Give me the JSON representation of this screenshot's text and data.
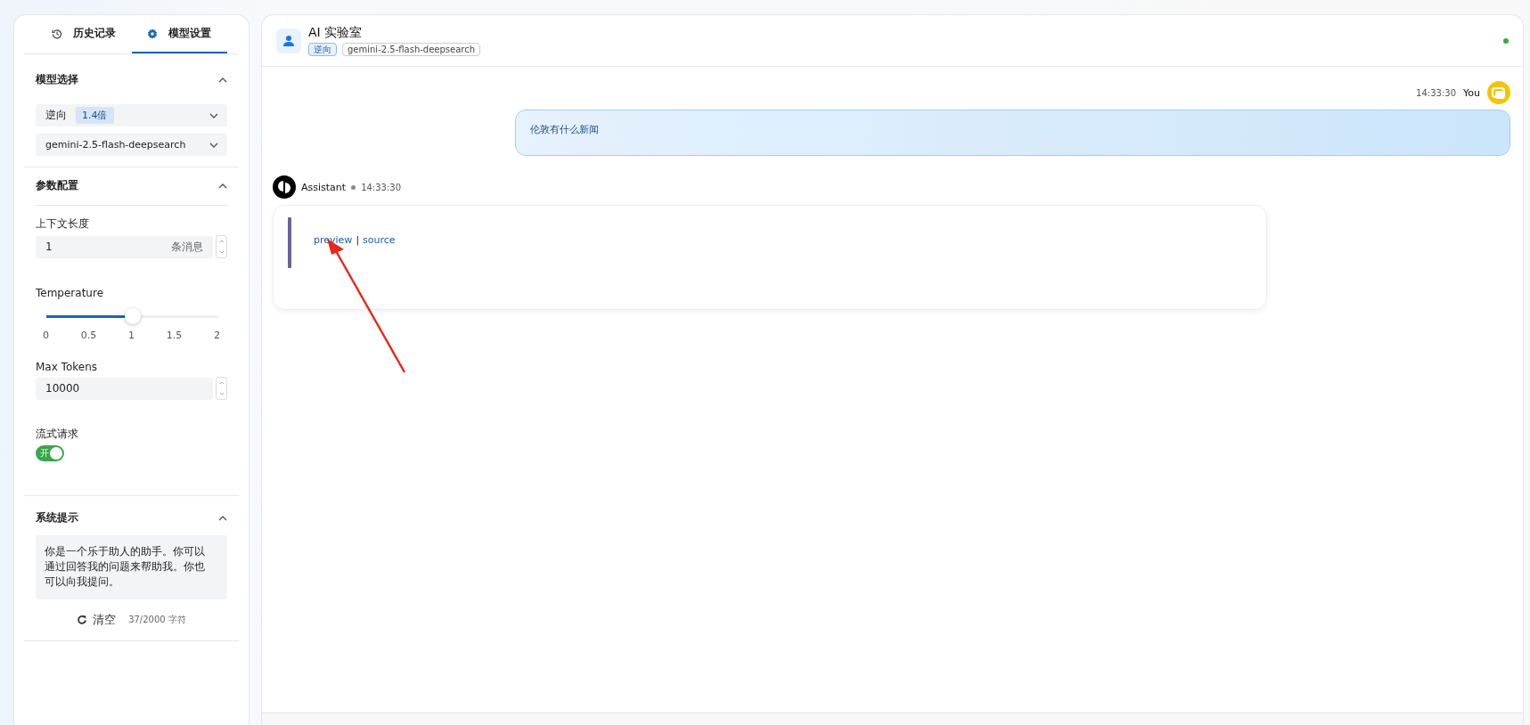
{
  "sidebar": {
    "tabs": [
      {
        "label": "历史记录",
        "kind": "history",
        "selected": false
      },
      {
        "label": "模型设置",
        "kind": "settings",
        "selected": true
      }
    ],
    "model_section": {
      "title": "模型选择",
      "expanded": true,
      "provider": {
        "value": "逆向",
        "badge": "1.4倍"
      },
      "model": {
        "value": "gemini-2.5-flash-deepsearch"
      }
    },
    "params_section": {
      "title": "参数配置",
      "expanded": true,
      "context_length": {
        "label": "上下文长度",
        "value": "1",
        "unit": "条消息"
      },
      "temperature": {
        "label": "Temperature",
        "level": 0.5,
        "ticks": [
          "0",
          "0.5",
          "1",
          "1.5",
          "2"
        ]
      },
      "max_tokens": {
        "label": "Max Tokens",
        "value": "10000"
      },
      "stream": {
        "label": "流式请求",
        "on": true,
        "on_text": "开"
      }
    },
    "system_section": {
      "title": "系统提示",
      "expanded": true,
      "text": "你是一个乐于助人的助手。你可以通过回答我的问题来帮助我。你也可以向我提问。",
      "clear_label": "清空",
      "count": "37/2000 字符"
    }
  },
  "chat": {
    "title": "AI 实验室",
    "tags": [
      {
        "label": "逆向",
        "kind": "mode"
      },
      {
        "label": "gemini-2.5-flash-deepsearch",
        "kind": "model"
      }
    ],
    "online": true,
    "messages": [
      {
        "kind": "user",
        "name": "You",
        "time": "14:33:30",
        "text": "伦敦有什么新闻"
      },
      {
        "kind": "assistant",
        "name": "Assistant",
        "time": "14:33:30",
        "links": [
          "preview",
          "source"
        ],
        "separator": "|"
      }
    ]
  }
}
